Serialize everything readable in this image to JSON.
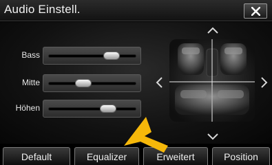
{
  "header": {
    "title": "Audio Einstell.",
    "close_icon": "close-icon"
  },
  "sliders": [
    {
      "name": "bass",
      "label": "Bass",
      "level": 0.72
    },
    {
      "name": "mitte",
      "label": "Mitte",
      "level": 0.4
    },
    {
      "name": "hoehen",
      "label": "Höhen",
      "level": 0.68
    }
  ],
  "balance": {
    "image": "car-interior-seats",
    "arrows": [
      "arrow-up-icon",
      "arrow-down-icon",
      "arrow-left-icon",
      "arrow-right-icon"
    ]
  },
  "tabs": [
    {
      "name": "tab-default",
      "label": "Default"
    },
    {
      "name": "tab-equalizer",
      "label": "Equalizer"
    },
    {
      "name": "tab-erweitert",
      "label": "Erweitert"
    },
    {
      "name": "tab-position",
      "label": "Position"
    }
  ],
  "colors": {
    "pointer": "#f6b80a",
    "background": "#000000",
    "text": "#ffffff"
  }
}
